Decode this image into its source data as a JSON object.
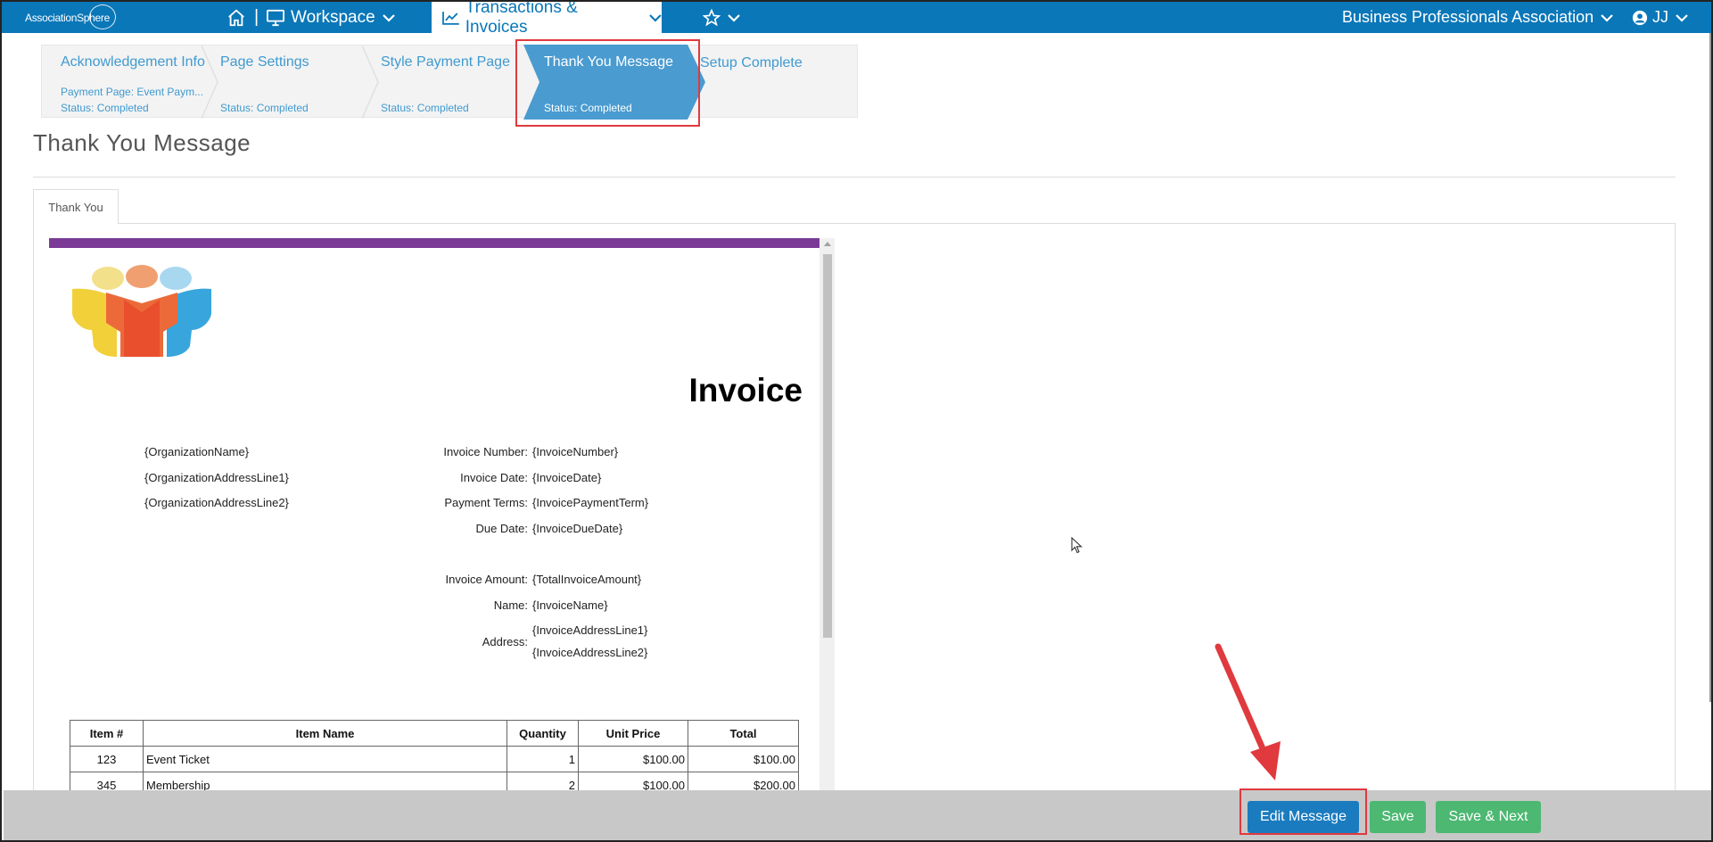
{
  "nav": {
    "brand": "AssociationSphere",
    "workspace_label": "Workspace",
    "transactions_label": "Transactions & Invoices",
    "org_label": "Business Professionals Association",
    "user_initials": "JJ"
  },
  "steps": [
    {
      "title": "Acknowledgement Info",
      "sub": "Payment Page: Event Paym...",
      "status": "Status: Completed"
    },
    {
      "title": "Page Settings",
      "sub": "",
      "status": "Status: Completed"
    },
    {
      "title": "Style Payment Page",
      "sub": "",
      "status": "Status: Completed"
    },
    {
      "title": "Thank You Message",
      "sub": "",
      "status": "Status: Completed"
    },
    {
      "title": "Setup Complete",
      "sub": "",
      "status": ""
    }
  ],
  "page_title": "Thank You Message",
  "tab_label": "Thank You",
  "invoice": {
    "heading": "Invoice",
    "org_lines": [
      "{OrganizationName}",
      "{OrganizationAddressLine1}",
      "{OrganizationAddressLine2}"
    ],
    "fields": [
      {
        "label": "Invoice Number:",
        "value": "{InvoiceNumber}"
      },
      {
        "label": "Invoice Date:",
        "value": "{InvoiceDate}"
      },
      {
        "label": "Payment Terms:",
        "value": "{InvoicePaymentTerm}"
      },
      {
        "label": "Due Date:",
        "value": "{InvoiceDueDate}"
      },
      {
        "label": "Invoice Amount:",
        "value": "{TotalInvoiceAmount}"
      },
      {
        "label": "Name:",
        "value": "{InvoiceName}"
      },
      {
        "label": "Address:",
        "value": "{InvoiceAddressLine1}",
        "value2": "{InvoiceAddressLine2}"
      }
    ],
    "table": {
      "headers": [
        "Item #",
        "Item Name",
        "Quantity",
        "Unit Price",
        "Total"
      ],
      "rows": [
        [
          "123",
          "Event Ticket",
          "1",
          "$100.00",
          "$100.00"
        ],
        [
          "345",
          "Membership",
          "2",
          "$100.00",
          "$200.00"
        ]
      ]
    }
  },
  "footer": {
    "edit_label": "Edit Message",
    "save_label": "Save",
    "save_next_label": "Save & Next"
  },
  "colors": {
    "nav_bg": "#0a77b8",
    "accent_purple": "#7b3a96",
    "active_step": "#4a9bd0",
    "annotation_red": "#e0393e",
    "button_blue": "#1a7bbf",
    "button_green": "#4cb872"
  }
}
